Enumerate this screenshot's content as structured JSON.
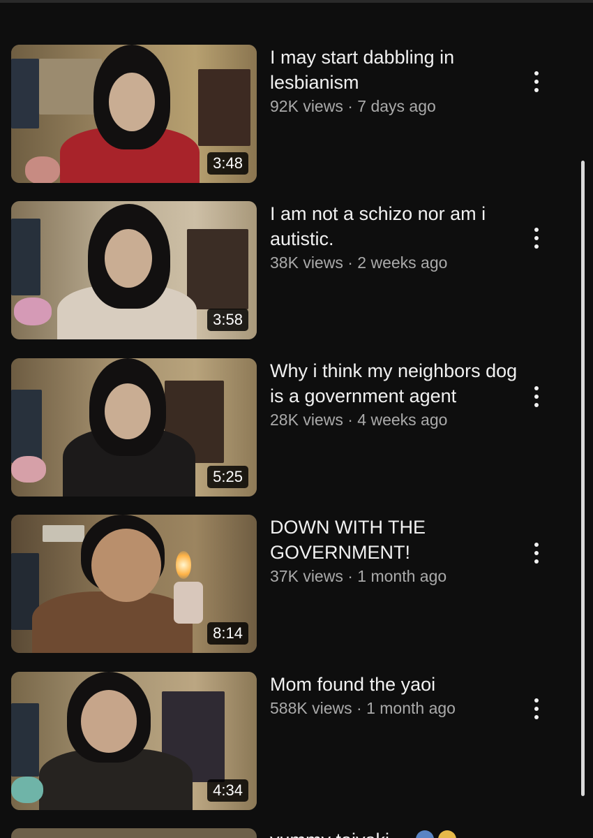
{
  "videos": [
    {
      "title": "I may start dabbling in lesbianism",
      "views": "92K views",
      "sep": " · ",
      "age": "7 days ago",
      "duration": "3:48",
      "thumb_colors": [
        "#7a6848",
        "#b19a6c",
        "#a6252a"
      ]
    },
    {
      "title": "I am not a schizo nor am i autistic.",
      "views": "38K views",
      "sep": " · ",
      "age": "2 weeks ago",
      "duration": "3:58",
      "thumb_colors": [
        "#8c7c61",
        "#c2b49b",
        "#d8cdbf"
      ]
    },
    {
      "title": "Why i think my neighbors dog is a government agent",
      "views": "28K views",
      "sep": " · ",
      "age": "4 weeks ago",
      "duration": "5:25",
      "thumb_colors": [
        "#6e5d43",
        "#a99574",
        "#1c1a1a"
      ]
    },
    {
      "title": "DOWN WITH THE GOVERNMENT!",
      "views": "37K views",
      "sep": " · ",
      "age": "1 month ago",
      "duration": "8:14",
      "thumb_colors": [
        "#5b4a34",
        "#8f7a58",
        "#6e4a31"
      ]
    },
    {
      "title": "Mom found the yaoi",
      "views": "588K views",
      "sep": " · ",
      "age": "1 month ago",
      "duration": "4:34",
      "thumb_colors": [
        "#7b6a4c",
        "#a89776",
        "#262320"
      ]
    }
  ],
  "partial": {
    "title": "yummy taiyaki"
  },
  "icons": {
    "more": "more-vert-icon",
    "emoji": "emoji-icon"
  }
}
